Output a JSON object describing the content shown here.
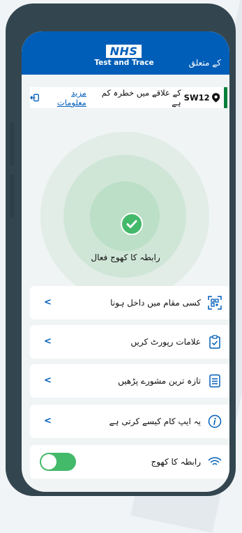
{
  "header": {
    "logo_text": "NHS",
    "app_title": "Test and Trace",
    "about_label": "کے متعلق"
  },
  "risk_banner": {
    "area_code": "SW12",
    "message": "کے علاقے میں خطرہ کم ہے",
    "more_info_label": "مزید معلومات"
  },
  "status": {
    "label": "رابطہ کا کھوج فعال"
  },
  "menu": {
    "items": [
      {
        "label": "کسی مقام میں داخل ہونا",
        "icon": "qr-scan-icon"
      },
      {
        "label": "علامات رپورٹ کریں",
        "icon": "clipboard-icon"
      },
      {
        "label": "تازہ ترین مشورے پڑھیں",
        "icon": "document-icon"
      },
      {
        "label": "یہ ایپ کام کیسے کرتی ہے",
        "icon": "info-icon"
      }
    ],
    "toggle_item": {
      "label": "رابطہ کا کھوج",
      "icon": "wifi-signal-icon",
      "enabled": true
    }
  },
  "colors": {
    "nhs_blue": "#005eb8",
    "active_green": "#43b96a",
    "banner_green": "#007f3b",
    "phone_frame": "#33464f"
  }
}
